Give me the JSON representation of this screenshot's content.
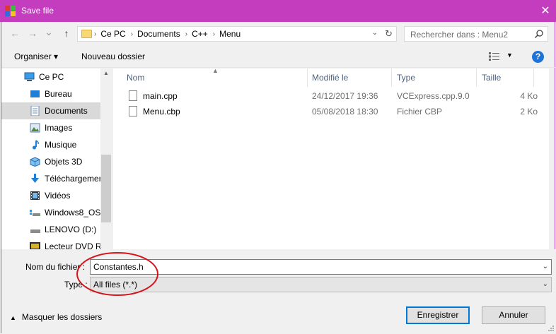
{
  "window": {
    "title": "Save file",
    "close_glyph": "✕"
  },
  "nav": {
    "back": "←",
    "forward": "→",
    "recent": "⌄",
    "up": "↑"
  },
  "address": {
    "crumbs": [
      "Ce PC",
      "Documents",
      "C++",
      "Menu"
    ],
    "separator": "›"
  },
  "search": {
    "placeholder": "Rechercher dans : Menu2"
  },
  "toolbar": {
    "organize": "Organiser ▾",
    "new_folder": "Nouveau dossier",
    "help": "?"
  },
  "sidebar": {
    "items": [
      {
        "label": "Ce PC",
        "icon": "computer-icon"
      },
      {
        "label": "Bureau",
        "icon": "desktop-icon"
      },
      {
        "label": "Documents",
        "icon": "documents-icon"
      },
      {
        "label": "Images",
        "icon": "images-icon"
      },
      {
        "label": "Musique",
        "icon": "music-icon"
      },
      {
        "label": "Objets 3D",
        "icon": "objects-3d-icon"
      },
      {
        "label": "Téléchargemer",
        "icon": "downloads-icon"
      },
      {
        "label": "Vidéos",
        "icon": "videos-icon"
      },
      {
        "label": "Windows8_OS",
        "icon": "drive-icon"
      },
      {
        "label": "LENOVO (D:)",
        "icon": "drive-icon"
      },
      {
        "label": "Lecteur DVD R\\",
        "icon": "dvd-icon"
      }
    ],
    "selected_index": 2
  },
  "filelist": {
    "columns": {
      "name": "Nom",
      "date": "Modifié le",
      "type": "Type",
      "size": "Taille"
    },
    "files": [
      {
        "name": "main.cpp",
        "date": "24/12/2017 19:36",
        "type": "VCExpress.cpp.9.0",
        "size": "4 Ko"
      },
      {
        "name": "Menu.cbp",
        "date": "05/08/2018 18:30",
        "type": "Fichier CBP",
        "size": "2 Ko"
      }
    ]
  },
  "form": {
    "filename_label": "Nom du fichier :",
    "filename_value": "Constantes.h",
    "type_label": "Type :",
    "type_value": "All files (*.*)",
    "annotation_color": "#d4151b"
  },
  "footer": {
    "hide_folders": "Masquer les dossiers",
    "save": "Enregistrer",
    "cancel": "Annuler"
  },
  "colors": {
    "titlebar": "#c43dbf",
    "accent": "#0078d7"
  }
}
